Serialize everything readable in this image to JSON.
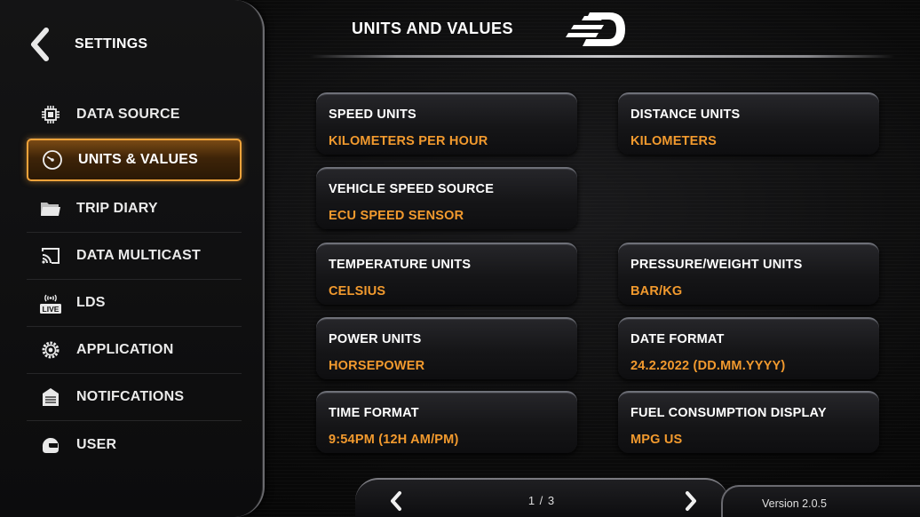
{
  "sidebar": {
    "title": "SETTINGS",
    "items": [
      {
        "label": "DATA SOURCE",
        "icon": "chip-icon"
      },
      {
        "label": "UNITS & VALUES",
        "icon": "gauge-icon",
        "active": true
      },
      {
        "label": "TRIP DIARY",
        "icon": "folder-icon"
      },
      {
        "label": "DATA MULTICAST",
        "icon": "cast-icon"
      },
      {
        "label": "LDS",
        "icon": "live-icon",
        "badge": "LIVE"
      },
      {
        "label": "APPLICATION",
        "icon": "gear-icon"
      },
      {
        "label": "NOTIFCATIONS",
        "icon": "notification-icon"
      },
      {
        "label": "USER",
        "icon": "helmet-icon"
      }
    ]
  },
  "header": {
    "title": "UNITS AND VALUES"
  },
  "settings": {
    "speed_units": {
      "label": "SPEED UNITS",
      "value": "KILOMETERS PER HOUR"
    },
    "distance_units": {
      "label": "DISTANCE UNITS",
      "value": "KILOMETERS"
    },
    "vehicle_speed_source": {
      "label": "VEHICLE SPEED SOURCE",
      "value": "ECU SPEED SENSOR"
    },
    "temperature_units": {
      "label": "TEMPERATURE UNITS",
      "value": "CELSIUS"
    },
    "pressure_weight_units": {
      "label": "PRESSURE/WEIGHT UNITS",
      "value": "BAR/KG"
    },
    "power_units": {
      "label": "POWER UNITS",
      "value": "HORSEPOWER"
    },
    "date_format": {
      "label": "DATE FORMAT",
      "value": "24.2.2022 (DD.MM.YYYY)"
    },
    "time_format": {
      "label": "TIME FORMAT",
      "value": "9:54PM (12H AM/PM)"
    },
    "fuel_consumption_display": {
      "label": "FUEL CONSUMPTION DISPLAY",
      "value": "MPG US"
    }
  },
  "pager": {
    "text": "1 / 3"
  },
  "version": "Version 2.0.5",
  "colors": {
    "accent": "#f29a2e",
    "active_border": "#f1a33a",
    "background": "#050505"
  }
}
